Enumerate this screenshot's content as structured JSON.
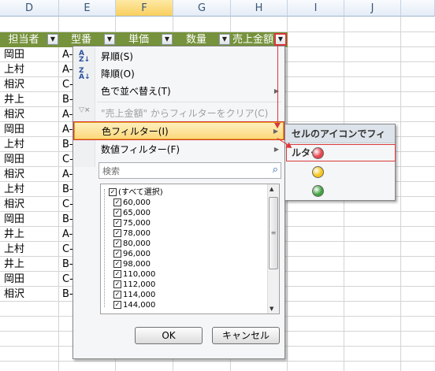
{
  "columns": [
    "D",
    "E",
    "F",
    "G",
    "H",
    "I",
    "J"
  ],
  "selected_column": "F",
  "table_headers": [
    "担当者",
    "型番",
    "単価",
    "数量",
    "売上金額"
  ],
  "rows_d": [
    "岡田",
    "上村",
    "相沢",
    "井上",
    "相沢",
    "岡田",
    "上村",
    "岡田",
    "相沢",
    "上村",
    "相沢",
    "岡田",
    "井上",
    "上村",
    "井上",
    "岡田",
    "相沢"
  ],
  "rows_e": [
    "A-",
    "A-",
    "C-",
    "B-",
    "A-",
    "A-",
    "B-",
    "C-",
    "A-",
    "B-",
    "C-",
    "B-",
    "A-",
    "C-",
    "B-",
    "C-",
    "B-"
  ],
  "menu": {
    "sort_asc": "昇順(S)",
    "sort_desc": "降順(O)",
    "sort_color": "色で並べ替え(T)",
    "clear_filter": "\"売上金額\" からフィルターをクリア(C)",
    "color_filter": "色フィルター(I)",
    "number_filter": "数値フィルター(F)",
    "search_placeholder": "検索",
    "list_items": [
      "(すべて選択)",
      "60,000",
      "65,000",
      "75,000",
      "78,000",
      "80,000",
      "96,000",
      "98,000",
      "110,000",
      "112,000",
      "114,000",
      "144,000"
    ],
    "ok": "OK",
    "cancel": "キャンセル"
  },
  "submenu": {
    "title": "セルのアイコンでフィルター",
    "icons": [
      {
        "name": "red-circle-icon",
        "color": "#e8414c"
      },
      {
        "name": "yellow-circle-icon",
        "color": "#f5c518"
      },
      {
        "name": "green-circle-icon",
        "color": "#3fa33d"
      }
    ]
  },
  "colors": {
    "header_fill": "#76923c",
    "highlight": "#d9383a"
  }
}
